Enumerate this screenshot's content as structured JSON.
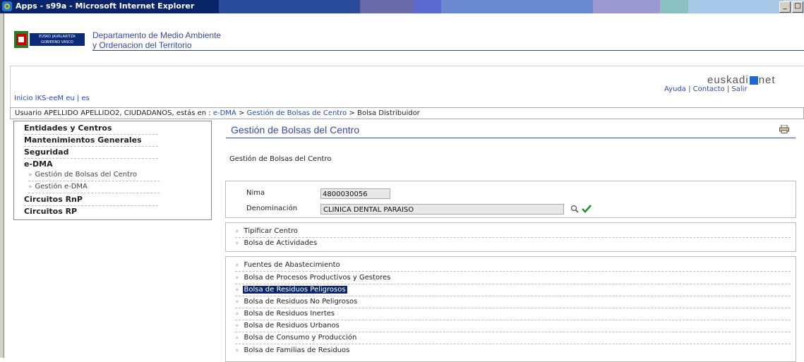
{
  "window": {
    "title": "Apps - s99a - Microsoft Internet Explorer",
    "minimize": "_",
    "maximize": "□"
  },
  "header": {
    "logo_text": "EUSKO JAURLARITZA GOBIERNO VASCO",
    "dept_line1": "Departamento de Medio Ambiente",
    "dept_line2": "y Ordenacion del Territorio",
    "brand_left": "euskadi",
    "brand_right": "net"
  },
  "top_links": {
    "inicio": "Inicio IKS-eeM eu | es",
    "ayuda": "Ayuda",
    "contacto": "Contacto",
    "salir": "Salir",
    "sep": " | "
  },
  "breadcrumb": {
    "prefix": "Usuario APELLIDO APELLIDO2, CIUDADANOS, estás en : ",
    "link1": "e-DMA",
    "sep": " > ",
    "link2": "Gestión de Bolsas de Centro",
    "current": "Bolsa Distribuidor"
  },
  "sidebar": {
    "items": [
      {
        "label": "Entidades y Centros"
      },
      {
        "label": "Mantenimientos Generales"
      },
      {
        "label": "Seguridad"
      },
      {
        "label": "e-DMA"
      },
      {
        "label": "Gestión de Bolsas del Centro"
      },
      {
        "label": "Gestión e-DMA"
      },
      {
        "label": "Circuitos RnP"
      },
      {
        "label": "Circuitos RP"
      }
    ],
    "arrow": "»"
  },
  "main": {
    "title": "Gestión de Bolsas del Centro",
    "subtitle": "Gestión de Bolsas del Centro",
    "form": {
      "nima_label": "Nima",
      "nima_value": "4800030056",
      "denom_label": "Denominación",
      "denom_value": "CLINICA DENTAL PARAISO"
    },
    "box1": [
      {
        "label": "Tipificar Centro"
      },
      {
        "label": "Bolsa de Actividades"
      }
    ],
    "box2": [
      {
        "label": "Fuentes de Abastecimiento"
      },
      {
        "label": "Bolsa de Procesos Productivos y Gestores"
      },
      {
        "label": "Bolsa de Residuos Peligrosos"
      },
      {
        "label": "Bolsa de Residuos No Peligrosos"
      },
      {
        "label": "Bolsa de Residuos Inertes"
      },
      {
        "label": "Bolsa de Residuos Urbanos"
      },
      {
        "label": "Bolsa de Consumo y Producción"
      },
      {
        "label": "Bolsa de Familias de Residuos"
      }
    ]
  },
  "colors": {
    "titlebar": "#0a246a",
    "link": "#2a4ab0",
    "heading": "#3a4aa0",
    "selected_bg": "#0a246a"
  }
}
